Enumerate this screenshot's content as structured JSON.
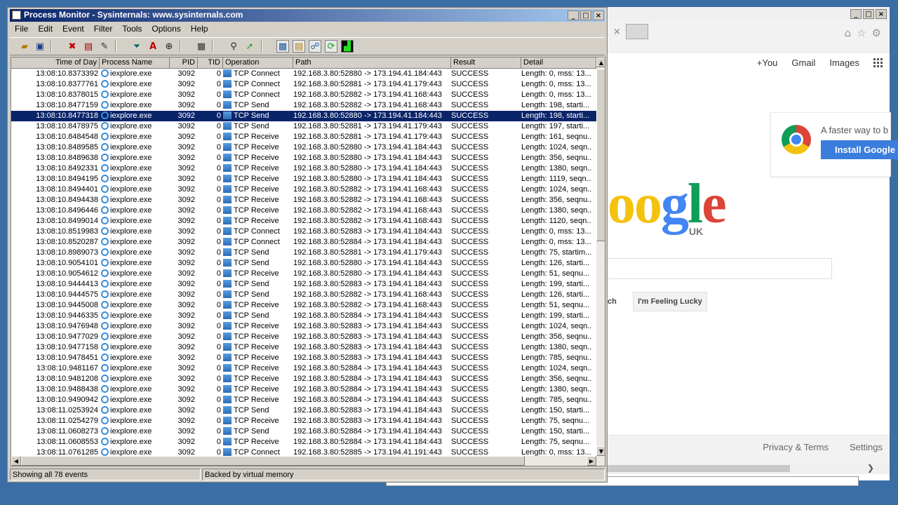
{
  "browser": {
    "tab_close": "×",
    "top_links": [
      "+You",
      "Gmail",
      "Images"
    ],
    "promo_text": "A faster way to b",
    "install_label": "Install Google",
    "logo_text": "oogle",
    "logo_region": "UK",
    "search_button_partial": "ch",
    "lucky_label": "I'm Feeling Lucky",
    "footer_links": [
      "Privacy & Terms",
      "Settings"
    ],
    "colors": {
      "blue": "#4285f4",
      "red": "#db4437",
      "yellow": "#f4c20d",
      "green": "#0f9d58"
    }
  },
  "procmon": {
    "title": "Process Monitor - Sysinternals: www.sysinternals.com",
    "menu": [
      "File",
      "Edit",
      "Event",
      "Filter",
      "Tools",
      "Options",
      "Help"
    ],
    "columns": [
      "Time of Day",
      "Process Name",
      "PID",
      "TID",
      "Operation",
      "Path",
      "Result",
      "Detail"
    ],
    "selected_index": 4,
    "rows": [
      [
        "13:08:10.8373392",
        "iexplore.exe",
        "3092",
        "0",
        "TCP Connect",
        "192.168.3.80:52880 -> 173.194.41.184:443",
        "SUCCESS",
        "Length: 0, mss: 13..."
      ],
      [
        "13:08:10.8377761",
        "iexplore.exe",
        "3092",
        "0",
        "TCP Connect",
        "192.168.3.80:52881 -> 173.194.41.179:443",
        "SUCCESS",
        "Length: 0, mss: 13..."
      ],
      [
        "13:08:10.8378015",
        "iexplore.exe",
        "3092",
        "0",
        "TCP Connect",
        "192.168.3.80:52882 -> 173.194.41.168:443",
        "SUCCESS",
        "Length: 0, mss: 13..."
      ],
      [
        "13:08:10.8477159",
        "iexplore.exe",
        "3092",
        "0",
        "TCP Send",
        "192.168.3.80:52882 -> 173.194.41.168:443",
        "SUCCESS",
        "Length: 198, starti..."
      ],
      [
        "13:08:10.8477318",
        "iexplore.exe",
        "3092",
        "0",
        "TCP Send",
        "192.168.3.80:52880 -> 173.194.41.184:443",
        "SUCCESS",
        "Length: 198, starti..."
      ],
      [
        "13:08:10.8478975",
        "iexplore.exe",
        "3092",
        "0",
        "TCP Send",
        "192.168.3.80:52881 -> 173.194.41.179:443",
        "SUCCESS",
        "Length: 197, starti..."
      ],
      [
        "13:08:10.8484548",
        "iexplore.exe",
        "3092",
        "0",
        "TCP Receive",
        "192.168.3.80:52881 -> 173.194.41.179:443",
        "SUCCESS",
        "Length: 161, seqnu..."
      ],
      [
        "13:08:10.8489585",
        "iexplore.exe",
        "3092",
        "0",
        "TCP Receive",
        "192.168.3.80:52880 -> 173.194.41.184:443",
        "SUCCESS",
        "Length: 1024, seqn..."
      ],
      [
        "13:08:10.8489638",
        "iexplore.exe",
        "3092",
        "0",
        "TCP Receive",
        "192.168.3.80:52880 -> 173.194.41.184:443",
        "SUCCESS",
        "Length: 356, seqnu..."
      ],
      [
        "13:08:10.8492331",
        "iexplore.exe",
        "3092",
        "0",
        "TCP Receive",
        "192.168.3.80:52880 -> 173.194.41.184:443",
        "SUCCESS",
        "Length: 1380, seqn..."
      ],
      [
        "13:08:10.8494195",
        "iexplore.exe",
        "3092",
        "0",
        "TCP Receive",
        "192.168.3.80:52880 -> 173.194.41.184:443",
        "SUCCESS",
        "Length: 1119, seqn..."
      ],
      [
        "13:08:10.8494401",
        "iexplore.exe",
        "3092",
        "0",
        "TCP Receive",
        "192.168.3.80:52882 -> 173.194.41.168:443",
        "SUCCESS",
        "Length: 1024, seqn..."
      ],
      [
        "13:08:10.8494438",
        "iexplore.exe",
        "3092",
        "0",
        "TCP Receive",
        "192.168.3.80:52882 -> 173.194.41.168:443",
        "SUCCESS",
        "Length: 356, seqnu..."
      ],
      [
        "13:08:10.8496446",
        "iexplore.exe",
        "3092",
        "0",
        "TCP Receive",
        "192.168.3.80:52882 -> 173.194.41.168:443",
        "SUCCESS",
        "Length: 1380, seqn..."
      ],
      [
        "13:08:10.8499014",
        "iexplore.exe",
        "3092",
        "0",
        "TCP Receive",
        "192.168.3.80:52882 -> 173.194.41.168:443",
        "SUCCESS",
        "Length: 1120, seqn..."
      ],
      [
        "13:08:10.8519983",
        "iexplore.exe",
        "3092",
        "0",
        "TCP Connect",
        "192.168.3.80:52883 -> 173.194.41.184:443",
        "SUCCESS",
        "Length: 0, mss: 13..."
      ],
      [
        "13:08:10.8520287",
        "iexplore.exe",
        "3092",
        "0",
        "TCP Connect",
        "192.168.3.80:52884 -> 173.194.41.184:443",
        "SUCCESS",
        "Length: 0, mss: 13..."
      ],
      [
        "13:08:10.8989073",
        "iexplore.exe",
        "3092",
        "0",
        "TCP Send",
        "192.168.3.80:52881 -> 173.194.41.179:443",
        "SUCCESS",
        "Length: 75, startim..."
      ],
      [
        "13:08:10.9054101",
        "iexplore.exe",
        "3092",
        "0",
        "TCP Send",
        "192.168.3.80:52880 -> 173.194.41.184:443",
        "SUCCESS",
        "Length: 126, starti..."
      ],
      [
        "13:08:10.9054612",
        "iexplore.exe",
        "3092",
        "0",
        "TCP Receive",
        "192.168.3.80:52880 -> 173.194.41.184:443",
        "SUCCESS",
        "Length: 51, seqnu..."
      ],
      [
        "13:08:10.9444413",
        "iexplore.exe",
        "3092",
        "0",
        "TCP Send",
        "192.168.3.80:52883 -> 173.194.41.184:443",
        "SUCCESS",
        "Length: 199, starti..."
      ],
      [
        "13:08:10.9444575",
        "iexplore.exe",
        "3092",
        "0",
        "TCP Send",
        "192.168.3.80:52882 -> 173.194.41.168:443",
        "SUCCESS",
        "Length: 126, starti..."
      ],
      [
        "13:08:10.9445008",
        "iexplore.exe",
        "3092",
        "0",
        "TCP Receive",
        "192.168.3.80:52882 -> 173.194.41.168:443",
        "SUCCESS",
        "Length: 51, seqnu..."
      ],
      [
        "13:08:10.9446335",
        "iexplore.exe",
        "3092",
        "0",
        "TCP Send",
        "192.168.3.80:52884 -> 173.194.41.184:443",
        "SUCCESS",
        "Length: 199, starti..."
      ],
      [
        "13:08:10.9476948",
        "iexplore.exe",
        "3092",
        "0",
        "TCP Receive",
        "192.168.3.80:52883 -> 173.194.41.184:443",
        "SUCCESS",
        "Length: 1024, seqn..."
      ],
      [
        "13:08:10.9477029",
        "iexplore.exe",
        "3092",
        "0",
        "TCP Receive",
        "192.168.3.80:52883 -> 173.194.41.184:443",
        "SUCCESS",
        "Length: 356, seqnu..."
      ],
      [
        "13:08:10.9477158",
        "iexplore.exe",
        "3092",
        "0",
        "TCP Receive",
        "192.168.3.80:52883 -> 173.194.41.184:443",
        "SUCCESS",
        "Length: 1380, seqn..."
      ],
      [
        "13:08:10.9478451",
        "iexplore.exe",
        "3092",
        "0",
        "TCP Receive",
        "192.168.3.80:52883 -> 173.194.41.184:443",
        "SUCCESS",
        "Length: 785, seqnu..."
      ],
      [
        "13:08:10.9481167",
        "iexplore.exe",
        "3092",
        "0",
        "TCP Receive",
        "192.168.3.80:52884 -> 173.194.41.184:443",
        "SUCCESS",
        "Length: 1024, seqn..."
      ],
      [
        "13:08:10.9481208",
        "iexplore.exe",
        "3092",
        "0",
        "TCP Receive",
        "192.168.3.80:52884 -> 173.194.41.184:443",
        "SUCCESS",
        "Length: 356, seqnu..."
      ],
      [
        "13:08:10.9488438",
        "iexplore.exe",
        "3092",
        "0",
        "TCP Receive",
        "192.168.3.80:52884 -> 173.194.41.184:443",
        "SUCCESS",
        "Length: 1380, seqn..."
      ],
      [
        "13:08:10.9490942",
        "iexplore.exe",
        "3092",
        "0",
        "TCP Receive",
        "192.168.3.80:52884 -> 173.194.41.184:443",
        "SUCCESS",
        "Length: 785, seqnu..."
      ],
      [
        "13:08:11.0253924",
        "iexplore.exe",
        "3092",
        "0",
        "TCP Send",
        "192.168.3.80:52883 -> 173.194.41.184:443",
        "SUCCESS",
        "Length: 150, starti..."
      ],
      [
        "13:08:11.0254279",
        "iexplore.exe",
        "3092",
        "0",
        "TCP Receive",
        "192.168.3.80:52883 -> 173.194.41.184:443",
        "SUCCESS",
        "Length: 75, seqnu..."
      ],
      [
        "13:08:11.0608273",
        "iexplore.exe",
        "3092",
        "0",
        "TCP Send",
        "192.168.3.80:52884 -> 173.194.41.184:443",
        "SUCCESS",
        "Length: 150, starti..."
      ],
      [
        "13:08:11.0608553",
        "iexplore.exe",
        "3092",
        "0",
        "TCP Receive",
        "192.168.3.80:52884 -> 173.194.41.184:443",
        "SUCCESS",
        "Length: 75, seqnu..."
      ],
      [
        "13:08:11.0761285",
        "iexplore.exe",
        "3092",
        "0",
        "TCP Connect",
        "192.168.3.80:52885 -> 173.194.41.191:443",
        "SUCCESS",
        "Length: 0, mss: 13..."
      ]
    ],
    "status_events": "Showing all 78 events",
    "status_memory": "Backed by virtual memory",
    "colors": {
      "selection": "#0a246a",
      "titlebar": "#0a246a",
      "chrome": "#d4d0c8"
    }
  }
}
